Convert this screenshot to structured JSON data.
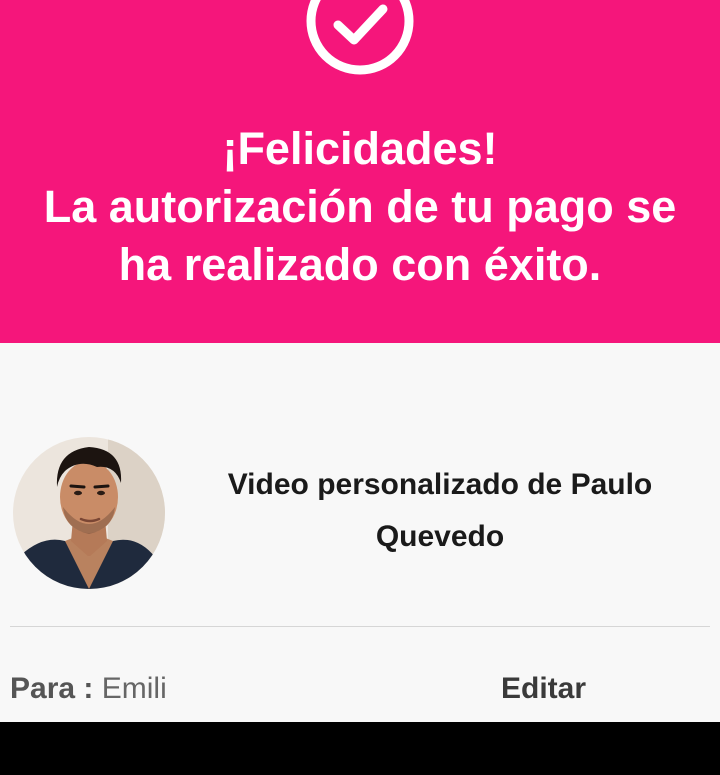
{
  "colors": {
    "banner": "#f5167b",
    "content_bg": "#f8f8f8",
    "text_dark": "#1a1a1a",
    "text_grey": "#555555"
  },
  "banner": {
    "icon": "check-circle-icon",
    "lines": [
      "¡Felicidades!",
      "La autorización de tu pago se",
      "ha realizado con éxito."
    ]
  },
  "product": {
    "avatar_icon": "celebrity-avatar",
    "title_lines": [
      "Video personalizado de Paulo",
      "Quevedo"
    ]
  },
  "recipient": {
    "label": "Para :",
    "value": "Emili",
    "edit_label": "Editar"
  }
}
